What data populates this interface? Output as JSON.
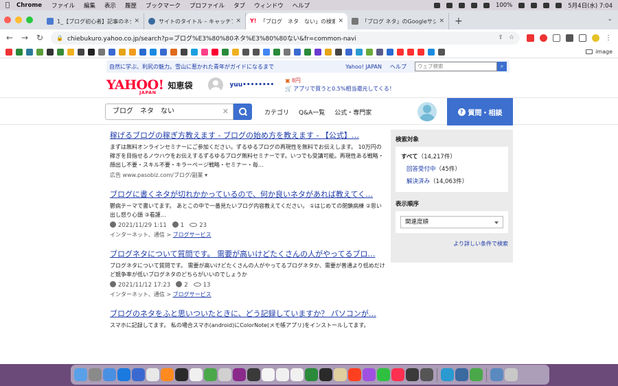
{
  "menubar": {
    "app": "Chrome",
    "items": [
      "ファイル",
      "編集",
      "表示",
      "履歴",
      "ブックマーク",
      "プロファイル",
      "タブ",
      "ウィンドウ",
      "ヘルプ"
    ],
    "battery": "100%",
    "datetime": "5月4日(水) 7:04"
  },
  "tabs": [
    {
      "title": "1_【ブログ初心者】記事のネタが見つ",
      "color": "#4a7bd1"
    },
    {
      "title": "サイトのタイトル – キャッチフレーズ",
      "color": "#3a6aa0"
    },
    {
      "title": "「ブログ　ネタ　ない」の検索結果 -",
      "color": "#ff0033",
      "active": true
    },
    {
      "title": "「ブログ ネタ」のGoogleサジェスト",
      "color": "#777777"
    }
  ],
  "omnibox": {
    "url": "chiebukuro.yahoo.co.jp/search?p=ブログ%E3%80%80ネタ%E3%80%80ない&fr=common-navi"
  },
  "bookmarks": {
    "colors": [
      "#e33",
      "#2a8a3a",
      "#2a7a9a",
      "#5c9e3a",
      "#333",
      "#3a8a3a",
      "#f0b020",
      "#444",
      "#222",
      "#777",
      "#3a6ad0",
      "#e6a417",
      "#f29c1f",
      "#2a6ad0",
      "#1a8ae0",
      "#3a6ad0",
      "#e06a1b",
      "#444",
      "#1aa0e0",
      "#ff4088",
      "#ff0033",
      "#2a8a3a",
      "#f0b020",
      "#555",
      "#555",
      "#4285f4",
      "#2a8a3a",
      "#777",
      "#3a6ad0",
      "#2a8a3a",
      "#6a3ad0",
      "#e6a417",
      "#444",
      "#3a6ad0",
      "#2a9ad0",
      "#6aaa3a",
      "#5a5a8a",
      "#2a6ad0",
      "#ff3030",
      "#ff3030",
      "#ff3030",
      "#1a8ae0",
      "#555"
    ],
    "folder": "image"
  },
  "yahoo": {
    "promo": "自然に学ぶ、利尻の魅力。雪山に惹かれた青年がガイドになるまで",
    "japan_link": "Yahoo! JAPAN",
    "help_link": "ヘルプ",
    "web_search_placeholder": "ウェブ検索",
    "logo": "YAHOO!",
    "logo_sub": "JAPAN",
    "chiebukuro": "知恵袋",
    "username": "yuu••••••••",
    "points": "8円",
    "app_promo": "アプリで買うと0.5%相当還元してくる！"
  },
  "search": {
    "query": "ブログ　ネタ　ない",
    "nav": [
      "カテゴリ",
      "Q&A一覧",
      "公式・専門家"
    ],
    "ask_button": "質問・相談"
  },
  "results": [
    {
      "title": "稼げるブログの稼ぎ方教えます - ブログの始め方を教えます - 【公式】…",
      "snippet": "まずは無料オンラインセミナーにご参加ください。ずるゆるブログの再現性を無料でお伝えします。 10万円の稼ぎを目指せるノウハウをお伝えするずるゆるブログ無料セミナーです。いつでも受講可能。再現性ある戦略・顔出し不要・スキル不要・キラーページ戦略・セミナー・毎…",
      "ad_label": "広告",
      "ad_url": "www.pasobiz.com/ブログ/副業 ▾"
    },
    {
      "title": "ブログに書くネタが切れかかっているので、何か良いネタがあれば教えてく…",
      "snippet": "鬱病テーマで書いてます。 あとこの中で一番見たいブログ内容教えてください。 ①はじめての閉鎖病棟 ②思い出し怒り心頭 ③看護…",
      "date": "2021/11/29 1:11",
      "answers": "1",
      "views": "23",
      "category": "インターネット、通信",
      "subcategory": "ブログサービス"
    },
    {
      "title": "ブログネタについて質問です。 需要が高いけどたくさんの人がやってるブロ…",
      "snippet": "ブログネタについて質問です。 需要が高いけどたくさんの人がやってるブログネタか、需要が普通より低めだけど競争率が低いブログネタのどちらがいいのでしょうか",
      "date": "2021/11/12 17:23",
      "answers": "2",
      "views": "13",
      "category": "インターネット、通信",
      "subcategory": "ブログサービス"
    },
    {
      "title": "ブログのネタをふと思いついたときに、どう記録していますか？ パソコンが…",
      "snippet": "スマホに記録してます。 私の場合スマホ(android)にColorNote(メモ帳アプリ)をインストールしてます。"
    }
  ],
  "sidebar": {
    "target_heading": "検索対象",
    "all": "すべて",
    "all_count": "（14,217件）",
    "open": "回答受付中",
    "open_count": "（45件）",
    "solved": "解決済み",
    "solved_count": "（14,063件）",
    "order_heading": "表示順序",
    "order_value": "関連度順",
    "more_link": "より詳しい条件で検索"
  },
  "dock": {
    "apps_left": [
      "#5aa0e8",
      "#8a8a8a",
      "#4a90e2",
      "#1a7ae0",
      "#3a6ad0",
      "#e8e8e8",
      "#ff8a20",
      "#2a2a2a",
      "#f0f0f0",
      "#4aa84a",
      "#d0d0d0",
      "#8a2a8a",
      "#3a3a3a",
      "#f4f4f4",
      "#f0f0f0",
      "#f0f0f0",
      "#2a8a3a",
      "#2a2a2a",
      "#e0d0a0",
      "#ff4020",
      "#a050e0",
      "#30c040",
      "#ff3050",
      "#3a3a3a",
      "#555555"
    ],
    "apps_right": [
      "#2a9ad0",
      "#3a6aa0",
      "#4aa84a"
    ],
    "trash": "#c8c8c8"
  }
}
